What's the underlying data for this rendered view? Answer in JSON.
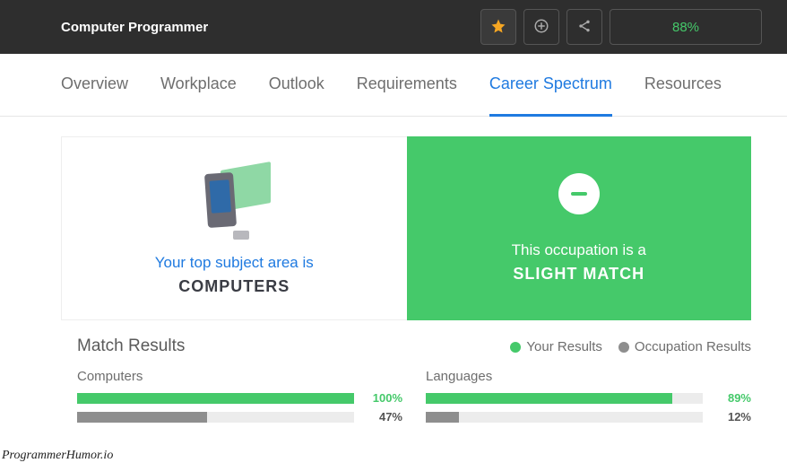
{
  "header": {
    "title": "Computer Programmer",
    "match_pct": "88%"
  },
  "tabs": [
    {
      "label": "Overview",
      "active": false
    },
    {
      "label": "Workplace",
      "active": false
    },
    {
      "label": "Outlook",
      "active": false
    },
    {
      "label": "Requirements",
      "active": false
    },
    {
      "label": "Career Spectrum",
      "active": true
    },
    {
      "label": "Resources",
      "active": false
    }
  ],
  "subject_card": {
    "line1": "Your top subject area is",
    "line2": "COMPUTERS"
  },
  "match_card": {
    "line1": "This occupation is a",
    "line2": "SLIGHT MATCH"
  },
  "results": {
    "title": "Match Results",
    "legend_your": "Your Results",
    "legend_occ": "Occupation Results",
    "groups": [
      {
        "label": "Computers",
        "your_pct": 100,
        "your_txt": "100%",
        "occ_pct": 47,
        "occ_txt": "47%"
      },
      {
        "label": "Languages",
        "your_pct": 89,
        "your_txt": "89%",
        "occ_pct": 12,
        "occ_txt": "12%"
      }
    ]
  },
  "watermark": "ProgrammerHumor.io"
}
